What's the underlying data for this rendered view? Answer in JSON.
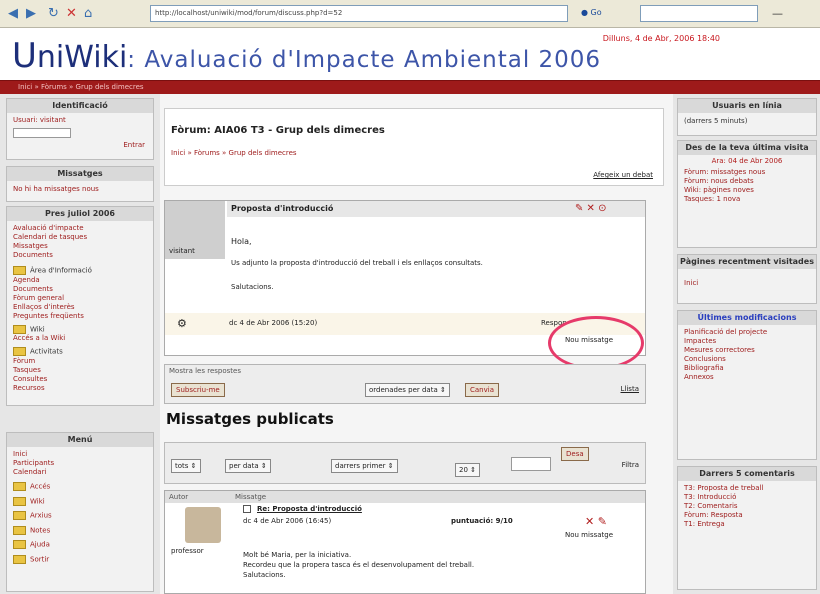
{
  "browser": {
    "url": "http://localhost/uniwiki/mod/forum/discuss.php?d=52",
    "go_label": "Go"
  },
  "header": {
    "logo_u": "U",
    "logo_rest": "niWiki",
    "subtitle": ": Avaluació d'Impacte Ambiental 2006",
    "date": "Dilluns, 4 de Abr, 2006 18:40"
  },
  "left": {
    "login_title": "Identificació",
    "login_text": "Usuari: visitant",
    "login_btn": "Entrar",
    "messages_title": "Missatges",
    "messages_link": "No hi ha missatges nous",
    "calendar_title": "Pres juliol 2006",
    "calendar_links": [
      "Avaluació d'impacte",
      "Calendari de tasques",
      "Missatges",
      "Documents"
    ],
    "folder1": "Àrea d'Informació",
    "folder1_links": [
      "Agenda",
      "Documents",
      "Fòrum general",
      "Enllaços d'interès",
      "Preguntes freqüents"
    ],
    "folder2": "Wiki",
    "folder2_link": "Accés a la Wiki",
    "folder3": "Activitats",
    "folder3_links": [
      "Fòrum",
      "Tasques",
      "Consultes",
      "Recursos"
    ],
    "menu_title": "Menú",
    "menu_links": [
      "Inici",
      "Participants",
      "Calendari"
    ],
    "menu_folders": [
      "Accés",
      "Wiki",
      "Arxius",
      "Notes",
      "Ajuda",
      "Sortir"
    ]
  },
  "main": {
    "title": "Fòrum: AIA06 T3 - Grup dels dimecres",
    "path": "Inici » Fòrums » Grup dels dimecres",
    "new_discussion": "Afegeix un debat",
    "post_subject": "Proposta d'introducció",
    "post_author": "visitant",
    "post_body1": "Hola,",
    "post_body2": "Us adjunto la proposta d'introducció del treball i els enllaços consultats.",
    "post_body3": "Salutacions.",
    "post_date": "dc 4 de Abr 2006 (15:20)",
    "reply_link": "Respon",
    "new_message": "Nou missatge",
    "panel_title": "Mostra les respostes",
    "panel_btn": "Subscriu-me",
    "panel_select": "ordenades per data",
    "panel_btn2": "Canvia",
    "panel_link": "Llista",
    "section": "Missatges publicats",
    "filter1": "tots",
    "filter2": "per data",
    "filter3": "darrers primer",
    "filter4": "20",
    "filter_btn": "Desa",
    "filter_label": "Filtra",
    "table_h1": "Autor",
    "table_h2": "Missatge",
    "row_subject": "Re: Proposta d'introducció",
    "row_date": "dc 4 de Abr 2006 (16:45)",
    "row_tag": "puntuació: 9/10",
    "row_author": "professor",
    "row_reply": "Nou missatge",
    "row_body1": "Molt bé Maria, per la iniciativa.",
    "row_body2": "Recordeu que la propera tasca és el desenvolupament del treball.",
    "row_body3": "Salutacions."
  },
  "right": {
    "online_title": "Usuaris en línia",
    "online_link": "(darrers 5 minuts)",
    "last_visit_title": "Des de la teva última visita",
    "last_visit_date": "Ara: 04 de Abr 2006",
    "last_visit_links": [
      "Fòrum: missatges nous",
      "Fòrum: nous debats",
      "Wiki: pàgines noves",
      "Tasques: 1 nova"
    ],
    "recent_title": "Pàgines recentment visitades",
    "recent_link": "Inici",
    "wiki_title": "Últimes modificacions",
    "wiki_links": [
      "Planificació del projecte",
      "Impactes",
      "Mesures correctores",
      "Conclusions",
      "Bibliografia",
      "Annexos"
    ],
    "comments_title": "Darrers 5 comentaris",
    "comments_links": [
      "T3: Proposta de treball",
      "T3: Introducció",
      "T2: Comentaris",
      "Fòrum: Resposta",
      "T1: Entrega"
    ]
  },
  "colors": {
    "accent": "#9d1a1a",
    "header_blue": "#1d2f7a",
    "circle": "#e63a6a"
  }
}
